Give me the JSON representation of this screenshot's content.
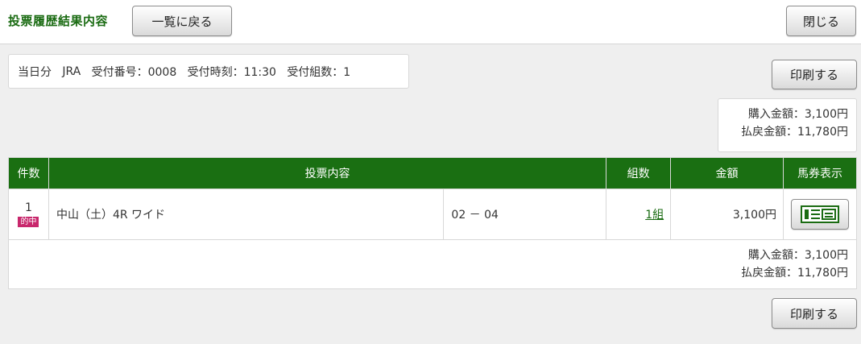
{
  "header": {
    "title": "投票履歴結果内容",
    "back_label": "一覧に戻る",
    "close_label": "閉じる"
  },
  "summary": {
    "day": "当日分",
    "org": "JRA",
    "receipt_number": "受付番号：0008",
    "receipt_time": "受付時刻：11:30",
    "receipt_count": "受付組数：1"
  },
  "print_label": "印刷する",
  "totals": {
    "purchase": "購入金額：3,100円",
    "payout": "払戻金額：11,780円"
  },
  "table": {
    "headers": {
      "count": "件数",
      "content": "投票内容",
      "combos": "組数",
      "amount": "金額",
      "ticket": "馬券表示"
    },
    "rows": [
      {
        "index": "1",
        "badge": "的中",
        "race": "中山（土）4R ワイド",
        "selection": "02 － 04",
        "combos": "1組",
        "amount": "3,100円"
      }
    ]
  },
  "colors": {
    "brand_green": "#1a6f12",
    "hit_badge": "#c8276c"
  }
}
